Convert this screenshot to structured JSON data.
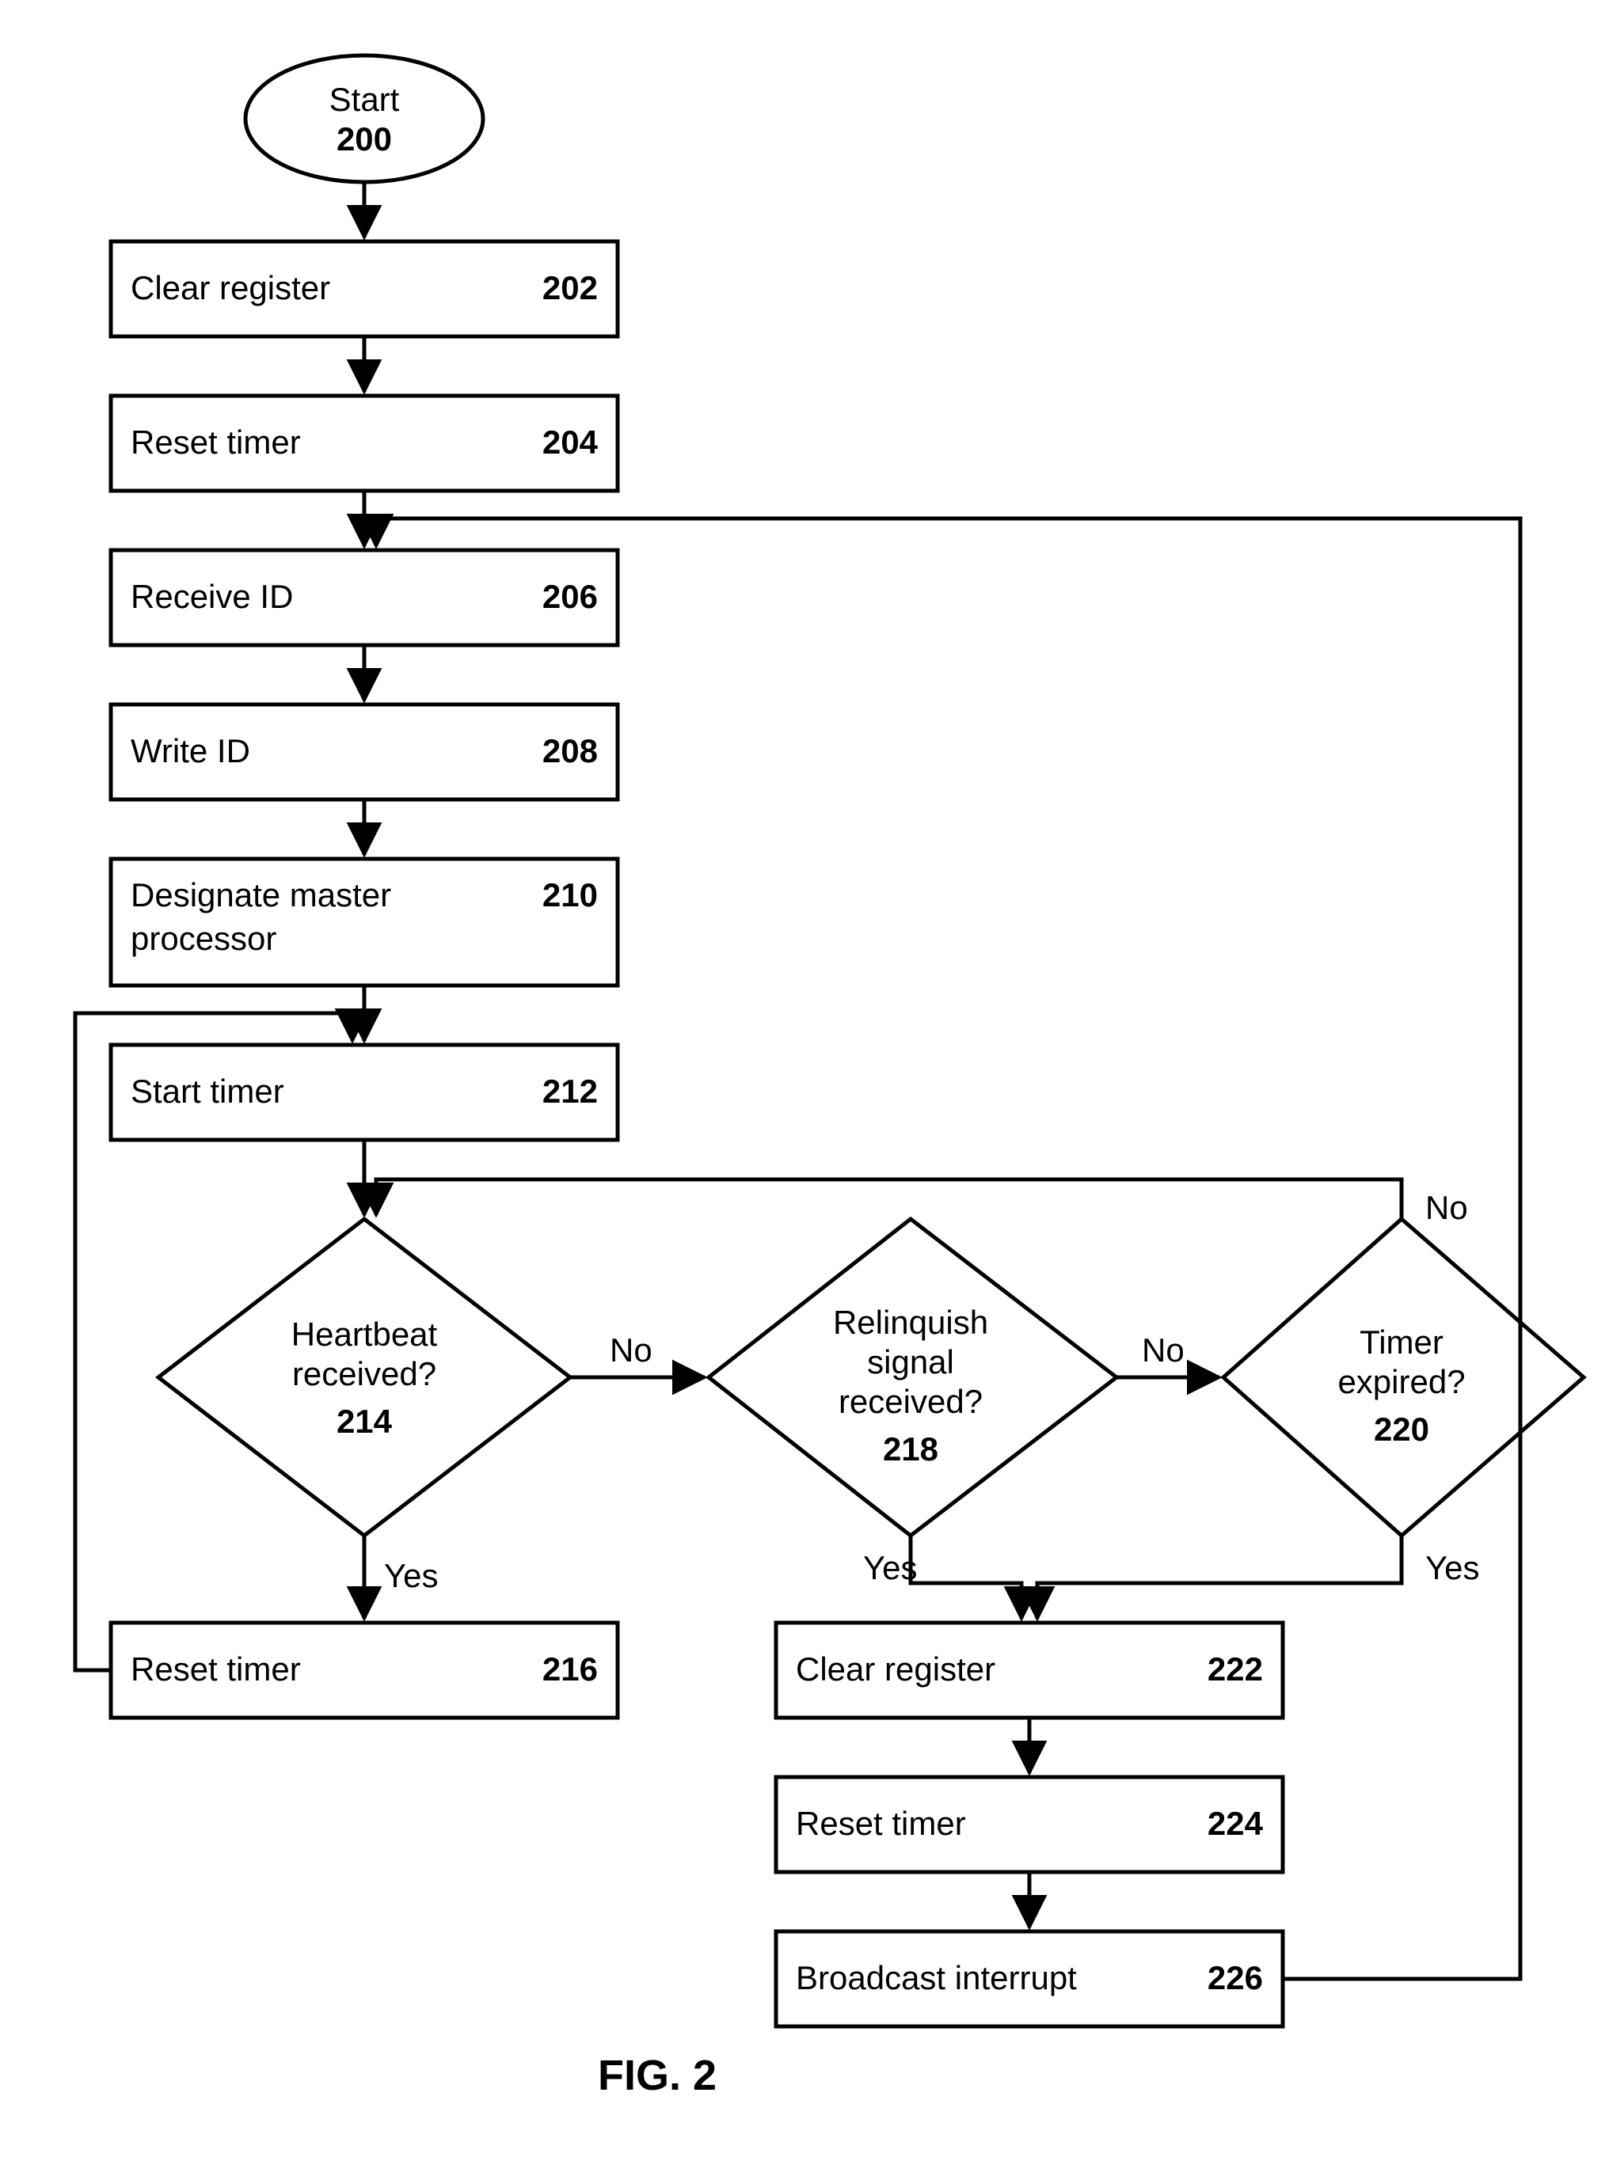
{
  "figure_label": "FIG. 2",
  "nodes": {
    "start": {
      "label": "Start",
      "num": "200"
    },
    "clear1": {
      "label": "Clear register",
      "num": "202"
    },
    "reset1": {
      "label": "Reset timer",
      "num": "204"
    },
    "recv": {
      "label": "Receive ID",
      "num": "206"
    },
    "write": {
      "label": "Write ID",
      "num": "208"
    },
    "designate": {
      "label": "Designate master",
      "label2": "processor",
      "num": "210"
    },
    "starttimer": {
      "label": "Start timer",
      "num": "212"
    },
    "heartbeat": {
      "label": "Heartbeat",
      "label2": "received?",
      "num": "214"
    },
    "reset2": {
      "label": "Reset timer",
      "num": "216"
    },
    "relinquish": {
      "label": "Relinquish",
      "label2": "signal",
      "label3": "received?",
      "num": "218"
    },
    "timer": {
      "label": "Timer",
      "label2": "expired?",
      "num": "220"
    },
    "clear2": {
      "label": "Clear register",
      "num": "222"
    },
    "reset3": {
      "label": "Reset timer",
      "num": "224"
    },
    "broadcast": {
      "label": "Broadcast interrupt",
      "num": "226"
    }
  },
  "edges": {
    "yes": "Yes",
    "no": "No"
  }
}
